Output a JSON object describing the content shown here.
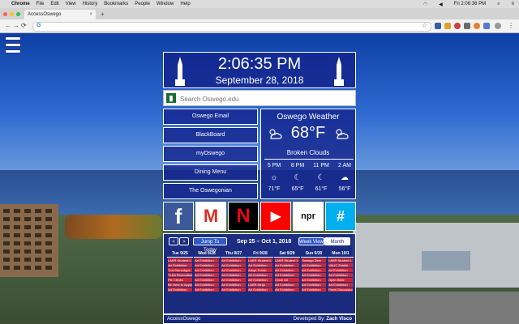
{
  "menubar": {
    "app": "Chrome",
    "items": [
      "File",
      "Edit",
      "View",
      "History",
      "Bookmarks",
      "People",
      "Window",
      "Help"
    ],
    "clock": "Fri 2:06:36 PM"
  },
  "browser": {
    "tab_title": "AccessOswego",
    "address": "",
    "omnibox_icon": "G"
  },
  "clock": {
    "time": "2:06:35 PM",
    "date": "September 28, 2018"
  },
  "search": {
    "placeholder": "Search Oswego.edu"
  },
  "links": [
    "Oswego Email",
    "BlackBoard",
    "myOswego",
    "Dining Menu",
    "The Oswegonian"
  ],
  "weather": {
    "title": "Oswego Weather",
    "temp": "68°F",
    "condition": "Broken Clouds",
    "forecast": [
      {
        "time": "5 PM",
        "temp": "71°F"
      },
      {
        "time": "8 PM",
        "temp": "65°F"
      },
      {
        "time": "11 PM",
        "temp": "61°F"
      },
      {
        "time": "2 AM",
        "temp": "56°F"
      }
    ]
  },
  "social": [
    {
      "name": "facebook",
      "glyph": "f",
      "bg": "#3b5998",
      "fg": "#ffffff"
    },
    {
      "name": "gmail",
      "glyph": "M",
      "bg": "#ffffff",
      "fg": "#d93025"
    },
    {
      "name": "netflix",
      "glyph": "N",
      "bg": "#000000",
      "fg": "#e50914"
    },
    {
      "name": "youtube",
      "glyph": "▶",
      "bg": "#ff0000",
      "fg": "#ffffff"
    },
    {
      "name": "npr",
      "glyph": "npr",
      "bg": "#ffffff",
      "fg": "#111111"
    },
    {
      "name": "groupme",
      "glyph": "#",
      "bg": "#00aff0",
      "fg": "#ffffff"
    }
  ],
  "calendar": {
    "prev": "<",
    "next": ">",
    "jump": "Jump To Today",
    "range": "Sep 25 – Oct 1, 2018",
    "week_view": "Week View",
    "month_view": "Month View",
    "days": [
      {
        "label": "Tue 9/25",
        "events": [
          "LAKR Student L",
          "Art Exhibition",
          "TLA Stereotype",
          "TLAA Recreation",
          "Pie Climbs",
          "Be Here to Apply",
          "Art Exhibition"
        ]
      },
      {
        "label": "Wed 9/26",
        "events": [
          "Art Exhibition",
          "Art Exhibition",
          "Art Exhibition",
          "Art Exhibition",
          "Art Exhibition",
          "Art Exhibition",
          "Art Exhibition"
        ]
      },
      {
        "label": "Thu 9/27",
        "events": [
          "Art Exhibition",
          "Art Exhibition",
          "Art Exhibition",
          "Art Exhibition",
          "Art Exhibition",
          "Art Exhibition",
          "Art Exhibition"
        ]
      },
      {
        "label": "Fri 9/28",
        "events": [
          "LAKR Student L",
          "Art Exhibition",
          "Adopt Public",
          "Art Exhibition",
          "Art Exhibition",
          "LAKR Ninja",
          "Art Exhibition"
        ]
      },
      {
        "label": "Sat 9/29",
        "events": [
          "LAKR Student L",
          "Art Exhibition",
          "Art Exhibition",
          "Art Exhibition",
          "Circle Art",
          "Art Exhibition",
          "Art Exhibition"
        ]
      },
      {
        "label": "Sun 9/30",
        "events": [
          "Oswego Dem",
          "Art Exhibition",
          "Art Exhibition",
          "Art Exhibition",
          "Art Exhibition",
          "Art Exhibition",
          "Art Exhibition"
        ]
      },
      {
        "label": "Mon 10/1",
        "events": [
          "LAKR Student L",
          "VALIC Exhibit",
          "Art Exhibition",
          "Art Exhibition",
          "Open Bible",
          "Art Exhibition",
          "Panel Discussion"
        ]
      }
    ]
  },
  "footer": {
    "left": "AccessOswego",
    "right_prefix": "Developed By:",
    "right_name": "Zach Visco"
  },
  "colors": {
    "panel": "#14238c",
    "event": "#c8283a"
  }
}
